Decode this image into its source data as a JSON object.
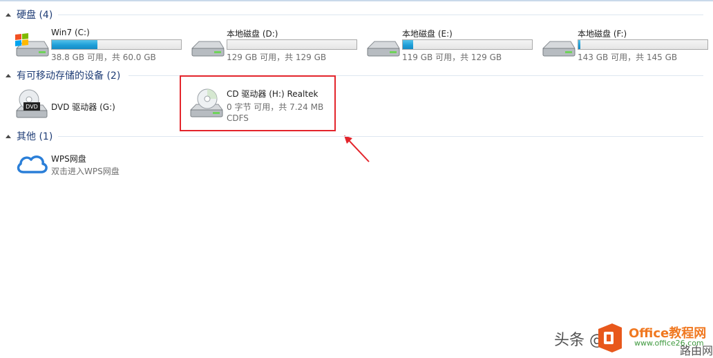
{
  "groups": {
    "hard_disks": {
      "title": "硬盘 (4)",
      "items": [
        {
          "name": "Win7 (C:)",
          "space": "38.8 GB 可用，共 60.0 GB",
          "used_fraction": 0.353
        },
        {
          "name": "本地磁盘 (D:)",
          "space": "129 GB 可用，共 129 GB",
          "used_fraction": 0.0
        },
        {
          "name": "本地磁盘 (E:)",
          "space": "119 GB 可用，共 129 GB",
          "used_fraction": 0.078
        },
        {
          "name": "本地磁盘 (F:)",
          "space": "143 GB 可用，共 145 GB",
          "used_fraction": 0.014
        }
      ]
    },
    "removable": {
      "title": "有可移动存储的设备 (2)",
      "items": [
        {
          "name": "DVD 驱动器 (G:)"
        },
        {
          "name": "CD 驱动器 (H:) Realtek",
          "space": "0 字节 可用，共 7.24 MB",
          "fs": "CDFS"
        }
      ]
    },
    "other": {
      "title": "其他 (1)",
      "items": [
        {
          "name": "WPS网盘",
          "desc": "双击进入WPS网盘"
        }
      ]
    }
  },
  "icons": {
    "hdd": "hard-drive-icon",
    "windows": "windows-logo-icon",
    "dvd": "dvd-drive-icon",
    "cd": "cd-drive-icon",
    "cloud": "cloud-icon"
  },
  "colors": {
    "group_title": "#1f3d76",
    "bar_fill": "#1f9fd8",
    "highlight": "#e3242b",
    "cloud": "#2b7fd8"
  },
  "watermark": {
    "text": "头条 @",
    "brand": "Office教程网",
    "url": "www.office26.com",
    "sub": "路由网"
  }
}
